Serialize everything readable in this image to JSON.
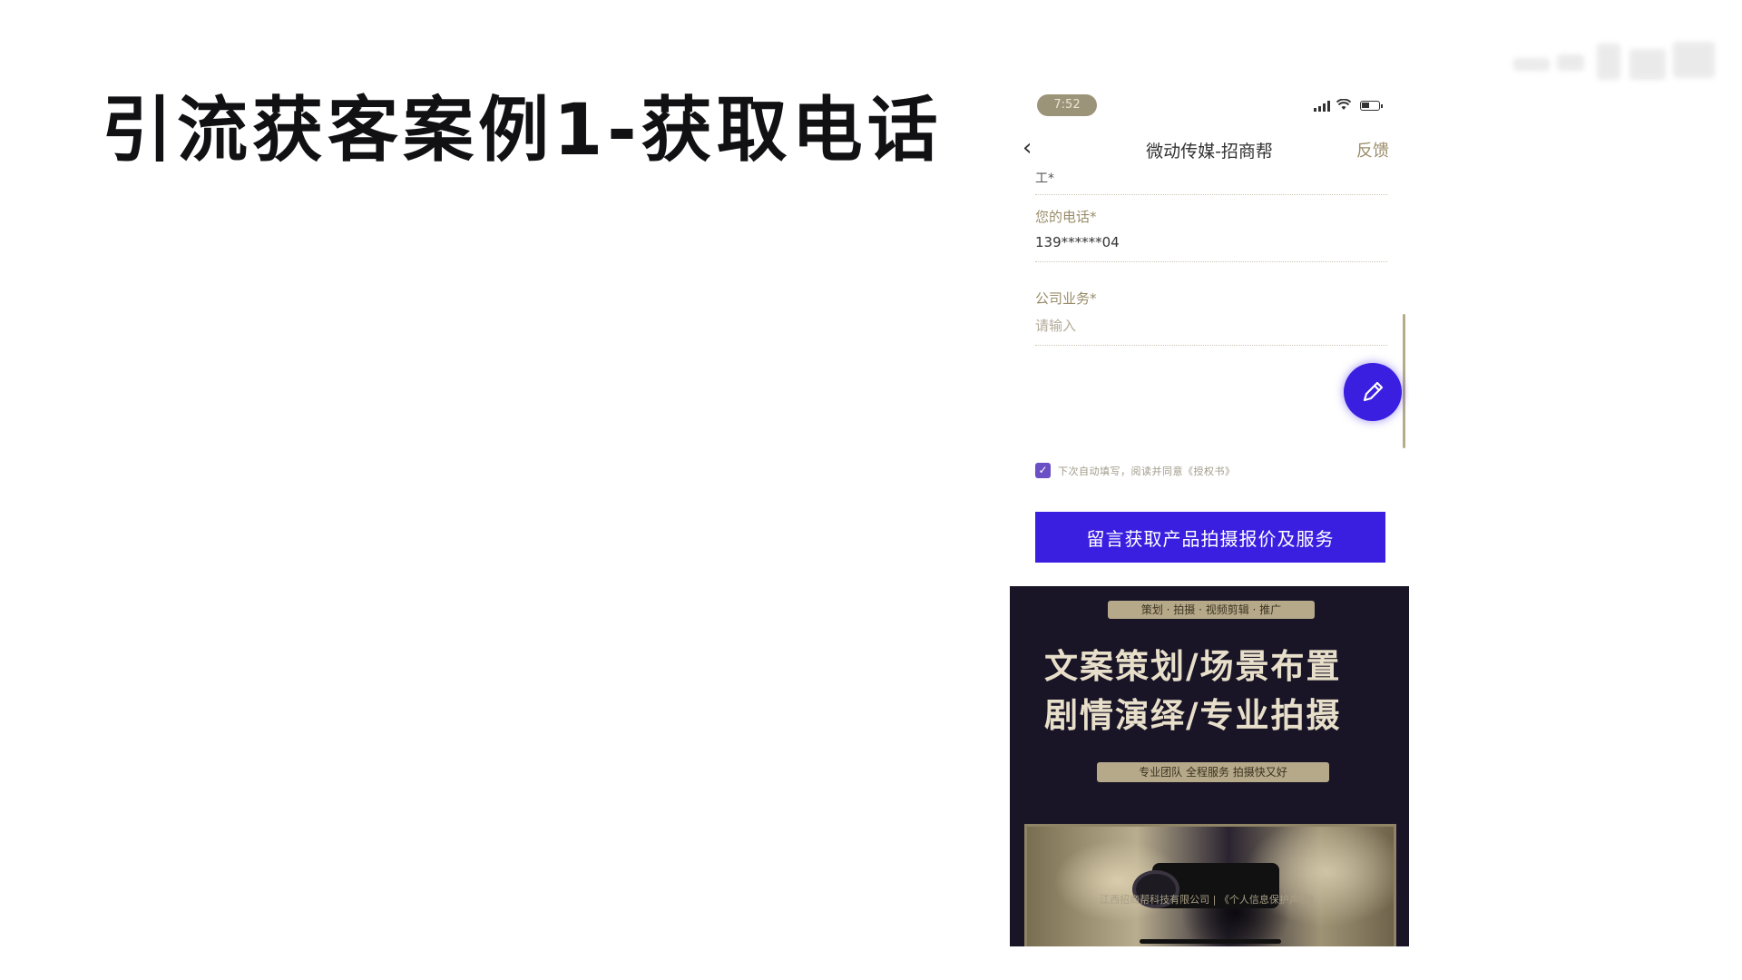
{
  "slide": {
    "title": "引流获客案例1-获取电话"
  },
  "phone": {
    "status_bar": {
      "time": "7:52"
    },
    "nav": {
      "title": "微动传媒-招商帮",
      "feedback": "反馈"
    },
    "form": {
      "prev_field_fragment": "工*",
      "phone_label": "您的电话*",
      "phone_value": "139******04",
      "business_label": "公司业务*",
      "business_placeholder": "请输入",
      "consent_text": "下次自动填写，阅读并同意《授权书》",
      "consent_checked": true,
      "submit_label": "留言获取产品拍摄报价及服务"
    },
    "poster": {
      "tag_top": "策划 · 拍摄 · 视频剪辑 · 推广",
      "headline_line1": "文案策划/场景布置",
      "headline_line2": "剧情演绎/专业拍摄",
      "tag_bottom": "专业团队 全程服务 拍摄快又好"
    },
    "footer": "江西招商帮科技有限公司 | 《个人信息保护声明》"
  },
  "colors": {
    "accent": "#3a1fe0",
    "gold": "#9a8c6a",
    "poster_bg": "#1a1526"
  }
}
